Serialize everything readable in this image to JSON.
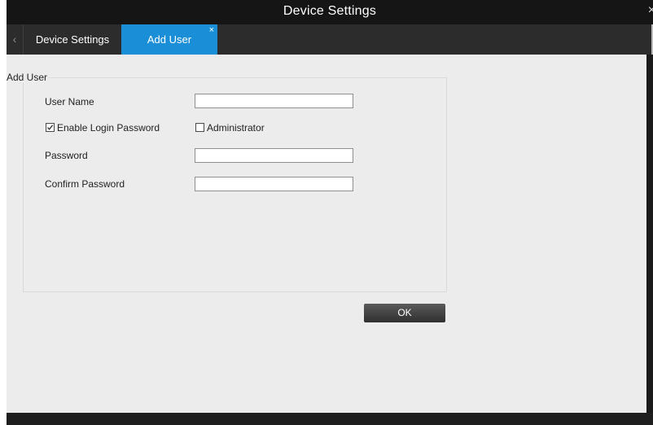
{
  "window": {
    "title": "Device Settings",
    "close_glyph": "×"
  },
  "tabs": {
    "back_glyph": "‹",
    "items": [
      {
        "label": "Device Settings",
        "active": false
      },
      {
        "label": "Add User",
        "active": true,
        "close_glyph": "×"
      }
    ]
  },
  "form": {
    "group_title": "Add User",
    "username_label": "User Name",
    "username_value": "",
    "enable_login_password_label": "Enable Login Password",
    "enable_login_password_checked": true,
    "administrator_label": "Administrator",
    "administrator_checked": false,
    "password_label": "Password",
    "password_value": "",
    "confirm_password_label": "Confirm Password",
    "confirm_password_value": "",
    "ok_label": "OK"
  },
  "colors": {
    "titlebar": "#151515",
    "tabbar": "#2c2c2c",
    "active_tab": "#1a8fd8",
    "content_bg": "#ececec"
  },
  "icons": {
    "back": "chevron-left-icon",
    "window_close": "close-icon",
    "tab_close": "close-icon",
    "checkbox_checked": "checkmark-icon"
  }
}
